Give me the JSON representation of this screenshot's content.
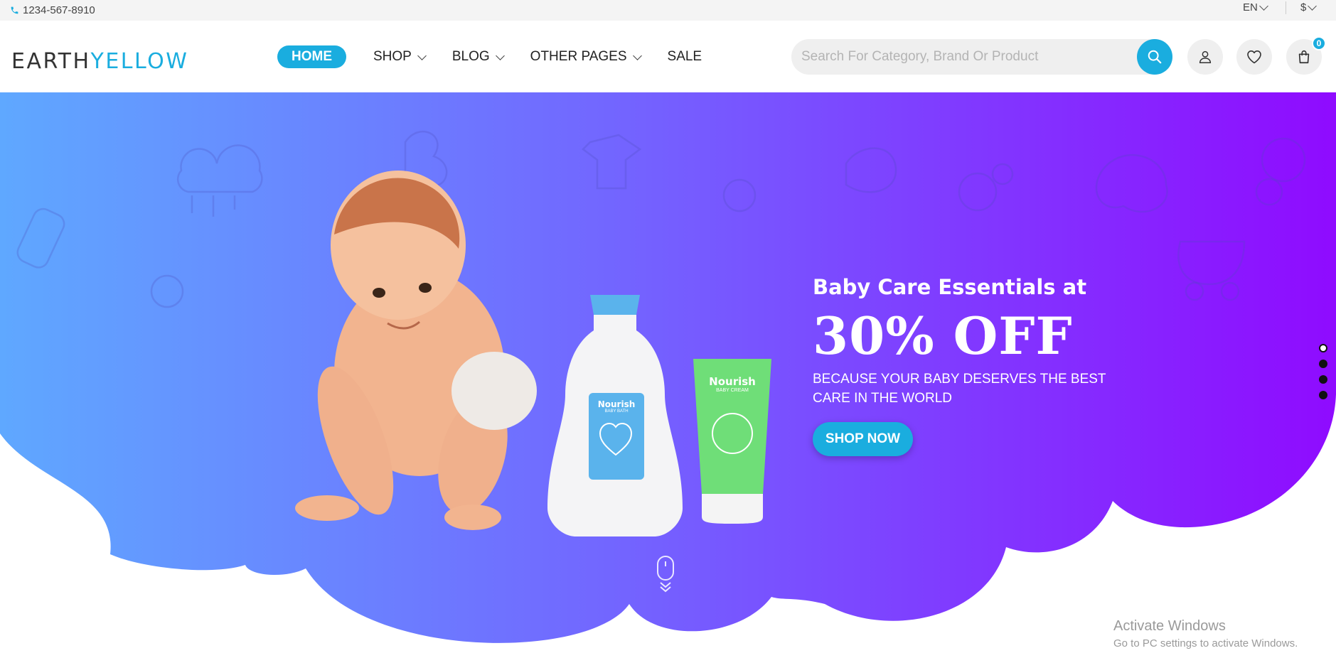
{
  "topbar": {
    "phone": "1234-567-8910",
    "language": "EN",
    "currency": "$"
  },
  "header": {
    "logo_part1": "EARTH",
    "logo_part2": "YELLOW",
    "nav": [
      {
        "label": "HOME",
        "active": true,
        "dropdown": false
      },
      {
        "label": "SHOP",
        "active": false,
        "dropdown": true
      },
      {
        "label": "BLOG",
        "active": false,
        "dropdown": true
      },
      {
        "label": "OTHER PAGES",
        "active": false,
        "dropdown": true
      },
      {
        "label": "SALE",
        "active": false,
        "dropdown": false
      }
    ],
    "search_placeholder": "Search For Category, Brand Or Product",
    "cart_count": "0"
  },
  "hero": {
    "pretitle": "Baby Care Essentials at",
    "title": "30% OFF",
    "subtitle": "BECAUSE YOUR BABY DESERVES THE BEST CARE IN THE WORLD",
    "cta": "SHOP NOW",
    "product1_brand": "Nourish",
    "product1_type": "BABY BATH",
    "product2_brand": "Nourish",
    "product2_type": "BABY CREAM",
    "slides_total": 4,
    "active_slide": 1
  },
  "watermark": {
    "line1": "Activate Windows",
    "line2": "Go to PC settings to activate Windows."
  },
  "colors": {
    "accent": "#1aaddf",
    "gradient_start": "#5fa8ff",
    "gradient_end": "#8f0bff"
  }
}
